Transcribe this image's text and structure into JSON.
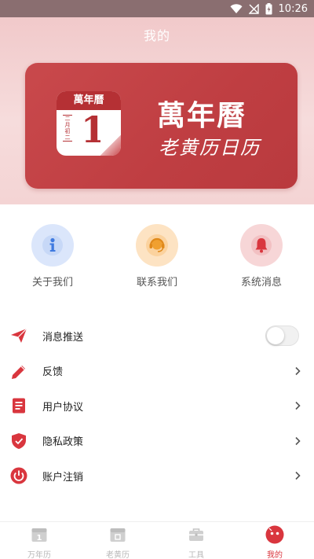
{
  "status_bar": {
    "time": "10:26"
  },
  "header": {
    "title": "我的",
    "banner": {
      "app_icon_top": "萬年曆",
      "app_icon_month": "二月初二",
      "app_icon_day": "1",
      "title": "萬年曆",
      "subtitle": "老黄历日历"
    }
  },
  "quick_actions": [
    {
      "label": "关于我们",
      "icon": "info-icon",
      "color": "#4a86e8"
    },
    {
      "label": "联系我们",
      "icon": "headset-icon",
      "color": "#f0a030"
    },
    {
      "label": "系统消息",
      "icon": "bell-icon",
      "color": "#d9363e"
    }
  ],
  "menu": {
    "push": {
      "label": "消息推送",
      "icon": "paper-plane-icon",
      "toggle_on": false
    },
    "feedback": {
      "label": "反馈",
      "icon": "pencil-icon"
    },
    "agreement": {
      "label": "用户协议",
      "icon": "document-icon"
    },
    "privacy": {
      "label": "隐私政策",
      "icon": "shield-icon"
    },
    "cancel_account": {
      "label": "账户注销",
      "icon": "power-icon"
    }
  },
  "bottom_nav": [
    {
      "label": "万年历",
      "icon": "calendar-icon",
      "active": false
    },
    {
      "label": "老黄历",
      "icon": "almanac-icon",
      "active": false
    },
    {
      "label": "工具",
      "icon": "toolbox-icon",
      "active": false
    },
    {
      "label": "我的",
      "icon": "profile-icon",
      "active": true
    }
  ],
  "colors": {
    "accent": "#d9363e",
    "banner": "#c4454a",
    "status_bar": "#8a6e70"
  }
}
